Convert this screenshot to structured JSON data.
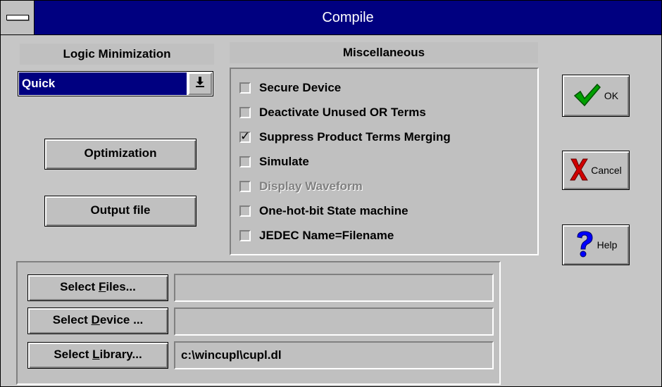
{
  "window": {
    "title": "Compile"
  },
  "logic_minimization": {
    "header": "Logic Minimization",
    "selected": "Quick",
    "dropdown_icon": "arrow-down-icon"
  },
  "buttons": {
    "optimization": "Optimization",
    "output_file": "Output file"
  },
  "miscellaneous": {
    "header": "Miscellaneous",
    "options": [
      {
        "label": "Secure Device",
        "checked": false,
        "enabled": true
      },
      {
        "label": "Deactivate Unused OR Terms",
        "checked": false,
        "enabled": true
      },
      {
        "label": "Suppress Product Terms Merging",
        "checked": true,
        "enabled": true,
        "mark": "✓"
      },
      {
        "label": "Simulate",
        "checked": false,
        "enabled": true
      },
      {
        "label": "Display Waveform",
        "checked": false,
        "enabled": false
      },
      {
        "label": "One-hot-bit State machine",
        "checked": false,
        "enabled": true
      },
      {
        "label": "JEDEC Name=Filename",
        "checked": false,
        "enabled": true
      }
    ]
  },
  "actions": {
    "ok": "OK",
    "cancel": "Cancel",
    "help": "Help"
  },
  "select": {
    "files": {
      "pre": "Select ",
      "accel": "F",
      "post": "iles...",
      "value": ""
    },
    "device": {
      "pre": "Select ",
      "accel": "D",
      "post": "evice ...",
      "value": ""
    },
    "library": {
      "pre": "Select ",
      "accel": "L",
      "post": "ibrary...",
      "value": "c:\\wincupl\\cupl.dl"
    }
  },
  "colors": {
    "title_bar": "#000080",
    "face": "#c0c0c0",
    "check_green": "#00a000",
    "cancel_red": "#d00000",
    "help_blue": "#0000ff"
  }
}
